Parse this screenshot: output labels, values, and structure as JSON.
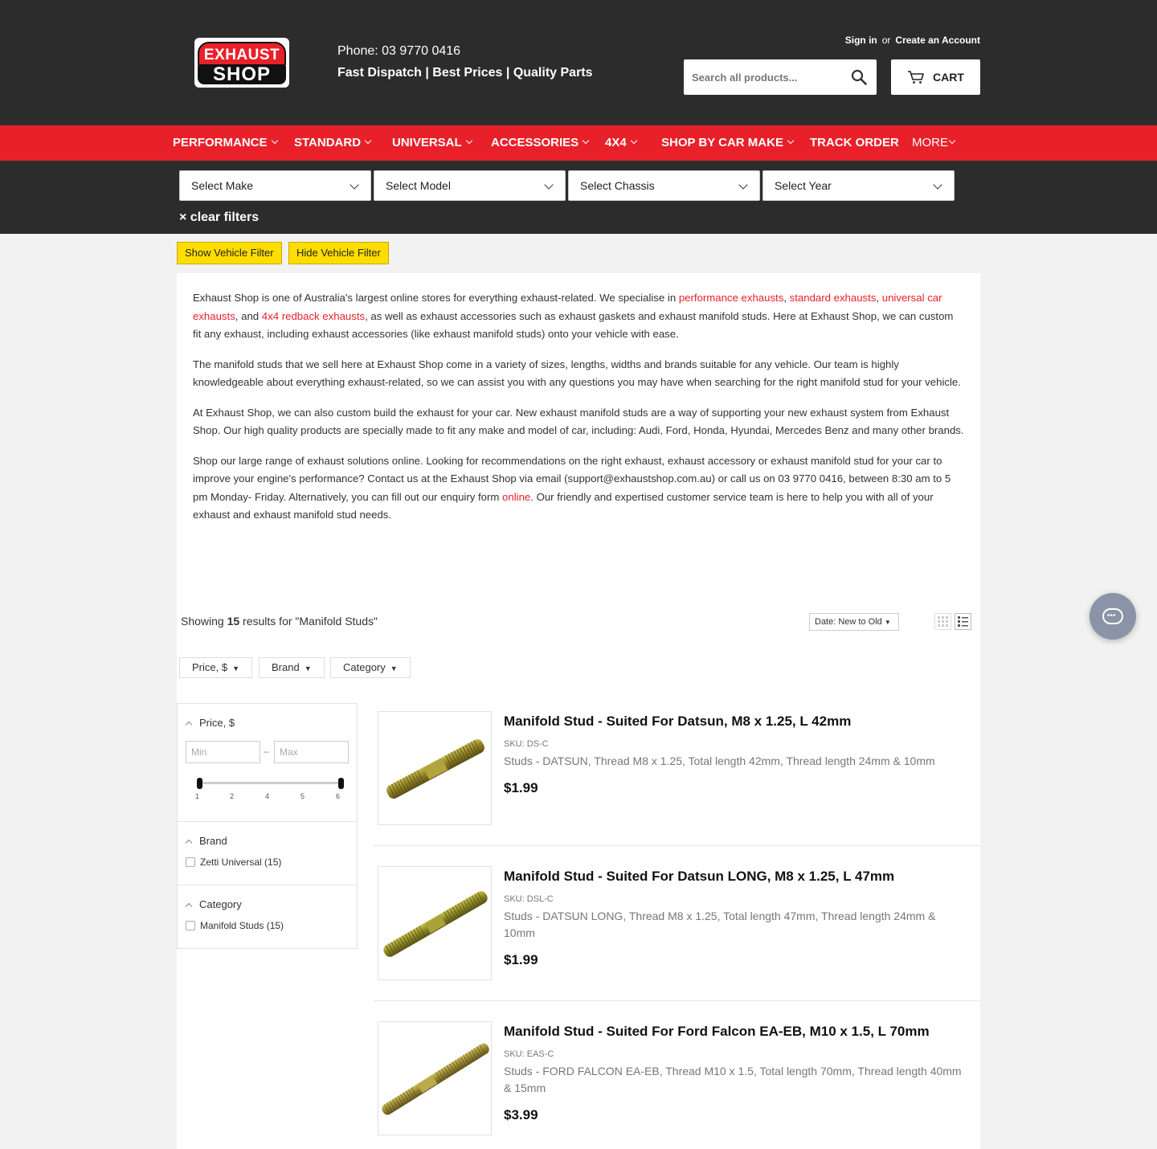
{
  "header": {
    "logo_top": "EXHAUST",
    "logo_bottom": "SHOP",
    "phone": "Phone: 03 9770 0416",
    "tagline": "Fast Dispatch | Best Prices | Quality Parts",
    "sign_in": "Sign in",
    "or": "or",
    "create_account": "Create an Account",
    "search_placeholder": "Search all products...",
    "cart_label": "CART"
  },
  "nav": {
    "items": [
      {
        "label": "PERFORMANCE",
        "has_dropdown": true
      },
      {
        "label": "STANDARD",
        "has_dropdown": true
      },
      {
        "label": "UNIVERSAL",
        "has_dropdown": true
      },
      {
        "label": "ACCESSORIES",
        "has_dropdown": true
      },
      {
        "label": "4X4",
        "has_dropdown": true
      },
      {
        "label": "SHOP BY CAR MAKE",
        "has_dropdown": true
      },
      {
        "label": "TRACK ORDER",
        "has_dropdown": false
      },
      {
        "label": "MORE",
        "has_dropdown": true
      }
    ]
  },
  "vehicle_filter": {
    "selects": [
      "Select Make",
      "Select Model",
      "Select Chassis",
      "Select Year"
    ],
    "clear": "× clear filters",
    "show_button": "Show Vehicle Filter",
    "hide_button": "Hide Vehicle Filter"
  },
  "description": {
    "p1_a": "Exhaust Shop is one of Australia's largest online stores for everything exhaust-related. We specialise in ",
    "link_performance": "performance exhausts",
    "comma1": ", ",
    "link_standard": "standard exhausts",
    "comma2": ", ",
    "link_universal": "universal car exhausts",
    "and": ", and ",
    "link_4x4": "4x4 redback exhausts",
    "p1_b": ", as well as exhaust accessories such as exhaust gaskets and exhaust manifold studs. Here at Exhaust Shop, we can custom fit any exhaust, including exhaust accessories (like exhaust manifold studs) onto your vehicle with ease.",
    "p2": "The manifold studs that we sell here at Exhaust Shop come in a variety of sizes, lengths, widths and brands suitable for any vehicle. Our team is highly knowledgeable about everything exhaust-related, so we can assist you with any questions you may have when searching for the right manifold stud for your vehicle.",
    "p3": "At Exhaust Shop, we can also custom build the exhaust for your car. New exhaust manifold studs are a way of supporting your new exhaust system from Exhaust Shop. Our high quality products are specially made to fit any make and model of car, including: Audi, Ford, Honda, Hyundai, Mercedes Benz and many other brands.",
    "p4_a": "Shop our large range of exhaust solutions online. Looking for recommendations on the right exhaust, exhaust accessory or exhaust manifold stud for your car to improve your engine's performance? Contact us at the Exhaust Shop via email (support@exhaustshop.com.au) or call us on 03 9770 0416, between 8:30 am to 5 pm Monday- Friday. Alternatively, you can fill out our enquiry form ",
    "link_online": "online",
    "p4_b": ". Our friendly and expertised customer service team is here to help you with all of your exhaust and exhaust manifold stud needs."
  },
  "results": {
    "prefix": "Showing ",
    "count": "15",
    "suffix": " results for \"Manifold Studs\"",
    "sort": "Date: New to Old"
  },
  "filter_chips": [
    "Price, $",
    "Brand",
    "Category"
  ],
  "sidebar": {
    "price_title": "Price, $",
    "min_placeholder": "Min",
    "max_placeholder": "Max",
    "dash": "–",
    "ticks": [
      "1",
      "2",
      "4",
      "5",
      "6"
    ],
    "brand_title": "Brand",
    "brand_option": "Zetti Universal (15)",
    "category_title": "Category",
    "category_option": "Manifold Studs (15)"
  },
  "products": [
    {
      "title": "Manifold Stud - Suited For Datsun, M8 x 1.25, L 42mm",
      "sku": "SKU: DS-C",
      "desc": "Studs - DATSUN, Thread M8 x 1.25, Total length 42mm, Thread length 24mm & 10mm",
      "price": "$1.99"
    },
    {
      "title": "Manifold Stud - Suited For Datsun LONG, M8 x 1.25, L 47mm",
      "sku": "SKU: DSL-C",
      "desc": "Studs - DATSUN LONG, Thread M8 x 1.25, Total length 47mm, Thread length 24mm & 10mm",
      "price": "$1.99"
    },
    {
      "title": "Manifold Stud - Suited For Ford Falcon EA-EB, M10 x 1.5, L 70mm",
      "sku": "SKU: EAS-C",
      "desc": "Studs - FORD FALCON EA-EB, Thread M10 x 1.5, Total length 70mm, Thread length 40mm & 15mm",
      "price": "$3.99"
    }
  ],
  "colors": {
    "brand_red": "#e8202a",
    "header_dark": "#2c2c2c",
    "filter_yellow": "#ffdd00"
  }
}
